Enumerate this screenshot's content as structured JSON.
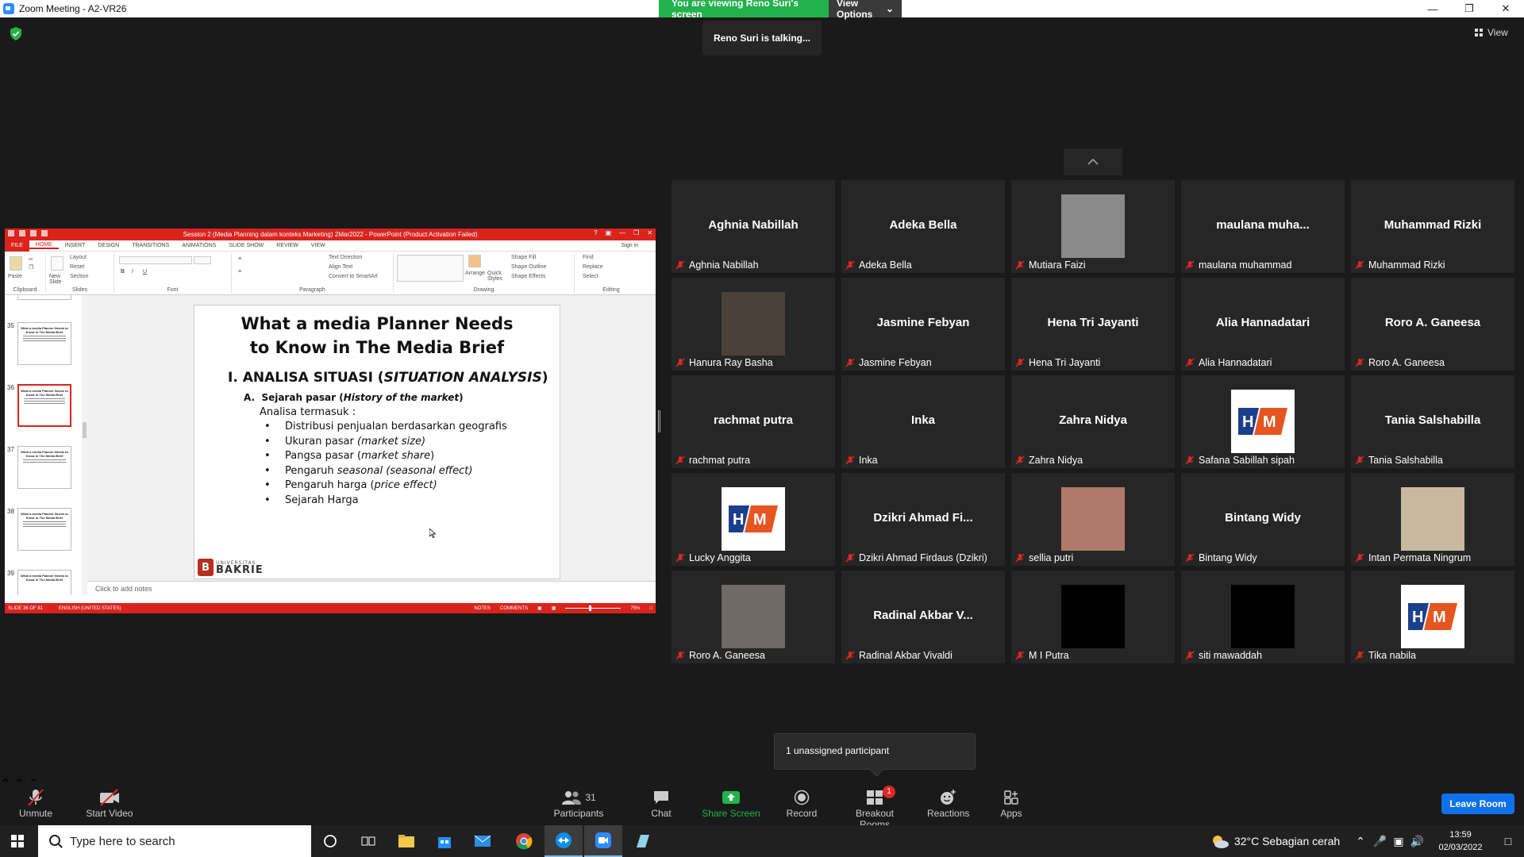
{
  "window": {
    "title": "Zoom Meeting - A2-VR26"
  },
  "banner": {
    "viewing": "You are viewing Reno Suri's screen",
    "options": "View Options"
  },
  "talking": "Reno Suri is talking...",
  "view_label": "View",
  "ppt": {
    "title": "Session 2 (Media Planning dalam konteks Marketing) 2Mar2022 - PowerPoint (Product Activation Failed)",
    "tabs": [
      "FILE",
      "HOME",
      "INSERT",
      "DESIGN",
      "TRANSITIONS",
      "ANIMATIONS",
      "SLIDE SHOW",
      "REVIEW",
      "VIEW"
    ],
    "signin": "Sign in",
    "ribbon": {
      "paste": "Paste",
      "new_slide": "New Slide",
      "layout": "Layout",
      "reset": "Reset",
      "section": "Section",
      "text_direction": "Text Direction",
      "align_text": "Align Text",
      "convert_smartart": "Convert to SmartArt",
      "arrange": "Arrange",
      "quick_styles": "Quick Styles",
      "shape_fill": "Shape Fill",
      "shape_outline": "Shape Outline",
      "shape_effects": "Shape Effects",
      "find": "Find",
      "replace": "Replace",
      "select": "Select",
      "groups": [
        "Clipboard",
        "Slides",
        "Font",
        "Paragraph",
        "Drawing",
        "Editing"
      ]
    },
    "thumbs": [
      {
        "num": "35",
        "title": "What a media Planner Needs to Know in The Media Brief"
      },
      {
        "num": "36",
        "title": "What a media Planner Needs to Know in The Media Brief"
      },
      {
        "num": "37",
        "title": "What a media Planner Needs to Know in The Media Brief"
      },
      {
        "num": "38",
        "title": "What a media Planner Needs to Know in The Media Brief"
      },
      {
        "num": "39",
        "title": "What a media Planner Needs to Know in The Media Brief"
      }
    ],
    "slide": {
      "title_line1": "What a media Planner Needs",
      "title_line2": "to Know in The Media Brief",
      "heading_plain": "I. ANALISA SITUASI (",
      "heading_italic": "SITUATION ANALYSIS",
      "heading_close": ")",
      "sub_letter": "A.",
      "sub_plain": "Sejarah pasar (",
      "sub_italic": "History of the market",
      "sub_close": ")",
      "intro": "Analisa termasuk :",
      "bullets": [
        {
          "plain": "Distribusi penjualan berdasarkan geografis",
          "italic": "",
          "close": ""
        },
        {
          "plain": "Ukuran pasar ",
          "italic": "(market size)",
          "close": ""
        },
        {
          "plain": "Pangsa pasar (",
          "italic": "market share",
          "close": ")"
        },
        {
          "plain": "Pengaruh ",
          "italic": "seasonal (seasonal effect)",
          "close": ""
        },
        {
          "plain": "Pengaruh harga (",
          "italic": "price effect)",
          "close": ""
        },
        {
          "plain": "Sejarah Harga",
          "italic": "",
          "close": ""
        }
      ],
      "logo_top": "UNIVERSITAS",
      "logo_bottom": "BAKRIE",
      "logo_letter": "B"
    },
    "notes": "Click to add notes",
    "status": {
      "slide": "SLIDE 36 OF 81",
      "lang": "ENGLISH (UNITED STATES)",
      "notes": "NOTES",
      "comments": "COMMENTS",
      "zoom": "75%"
    }
  },
  "participants": [
    {
      "big": "Aghnia Nabillah",
      "name": "Aghnia Nabillah",
      "type": "name"
    },
    {
      "big": "Adeka Bella",
      "name": "Adeka Bella",
      "type": "name"
    },
    {
      "big": "",
      "name": "Mutiara Faizi",
      "type": "photo",
      "color": "#8a8a8a"
    },
    {
      "big": "maulana  muha...",
      "name": "maulana muhammad",
      "type": "name"
    },
    {
      "big": "Muhammad Rizki",
      "name": "Muhammad Rizki",
      "type": "name"
    },
    {
      "big": "",
      "name": "Hanura Ray Basha",
      "type": "photo",
      "color": "#4a4238"
    },
    {
      "big": "Jasmine Febyan",
      "name": "Jasmine Febyan",
      "type": "name"
    },
    {
      "big": "Hena Tri Jayanti",
      "name": "Hena Tri Jayanti",
      "type": "name"
    },
    {
      "big": "Alia Hannadatari",
      "name": "Alia Hannadatari",
      "type": "name"
    },
    {
      "big": "Roro A. Ganeesa",
      "name": "Roro A. Ganeesa",
      "type": "name"
    },
    {
      "big": "rachmat putra",
      "name": "rachmat putra",
      "type": "name"
    },
    {
      "big": "Inka",
      "name": "Inka",
      "type": "name"
    },
    {
      "big": "Zahra Nidya",
      "name": "Zahra Nidya",
      "type": "name"
    },
    {
      "big": "",
      "name": "Safana Sabillah sipah",
      "type": "umb"
    },
    {
      "big": "Tania Salshabilla",
      "name": "Tania Salshabilla",
      "type": "name"
    },
    {
      "big": "",
      "name": "Lucky Anggita",
      "type": "umb"
    },
    {
      "big": "Dzikri  Ahmad  Fi...",
      "name": "Dzikri Ahmad Firdaus (Dzikri)",
      "type": "name"
    },
    {
      "big": "",
      "name": "sellia putri",
      "type": "photo",
      "color": "#b07a6a"
    },
    {
      "big": "Bintang Widy",
      "name": "Bintang Widy",
      "type": "name"
    },
    {
      "big": "",
      "name": "Intan Permata Ningrum",
      "type": "photo",
      "color": "#c9b8a0"
    },
    {
      "big": "",
      "name": "Roro A. Ganeesa",
      "type": "photo",
      "color": "#6f6a66"
    },
    {
      "big": "Radinal  Akbar  V...",
      "name": "Radinal Akbar Vivaldi",
      "type": "name"
    },
    {
      "big": "",
      "name": "M I Putra",
      "type": "black"
    },
    {
      "big": "",
      "name": "siti mawaddah",
      "type": "black"
    },
    {
      "big": "",
      "name": "Tika nabila",
      "type": "umb"
    }
  ],
  "unassigned": "1 unassigned participant",
  "toolbar": {
    "unmute": "Unmute",
    "start_video": "Start Video",
    "participants": "Participants",
    "participants_count": "31",
    "chat": "Chat",
    "share_screen": "Share Screen",
    "record": "Record",
    "breakout_rooms": "Breakout Rooms",
    "breakout_badge": "1",
    "reactions": "Reactions",
    "apps": "Apps",
    "leave": "Leave Room"
  },
  "taskbar": {
    "search_placeholder": "Type here to search",
    "weather": "32°C  Sebagian cerah",
    "time": "13:59",
    "date": "02/03/2022"
  },
  "colors": {
    "zoom_blue": "#0e71eb",
    "share_green": "#23b14d",
    "ppt_red": "#d9241d",
    "muted_red": "#e02828"
  }
}
